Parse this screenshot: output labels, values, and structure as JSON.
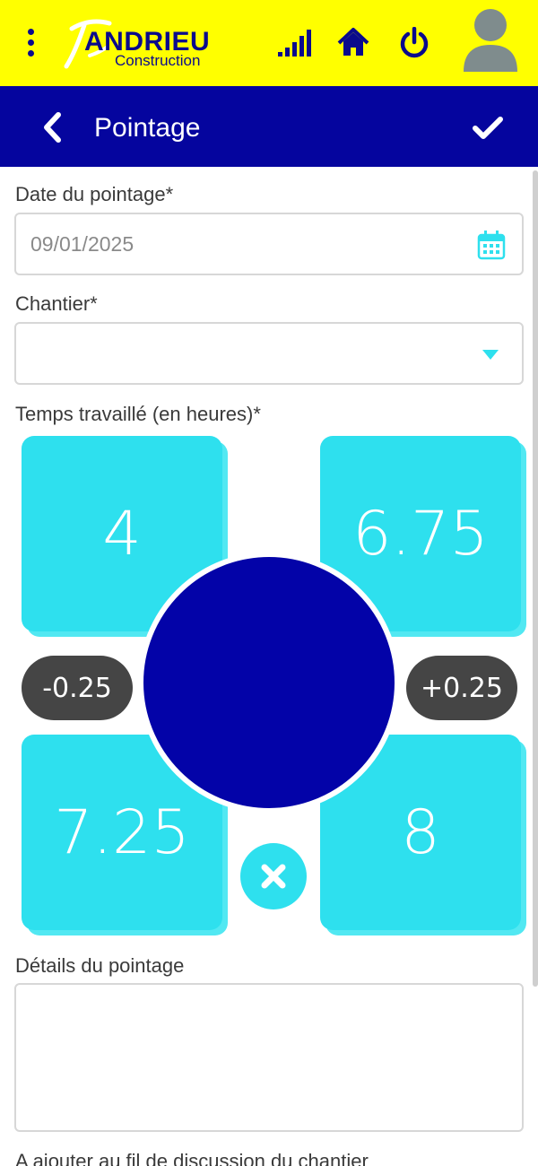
{
  "header": {
    "logo_name": "ANDRIEU",
    "logo_sub": "Construction",
    "icons": [
      "menu-dots-icon",
      "signal-icon",
      "home-icon",
      "power-icon",
      "avatar-icon"
    ],
    "colors": {
      "background": "#ffff00",
      "icons": "#0a0a8c"
    }
  },
  "navbar": {
    "title": "Pointage",
    "back_icon": "chevron-left-icon",
    "confirm_icon": "check-icon",
    "color": "#05059e"
  },
  "form": {
    "date_label": "Date du pointage*",
    "date_value": "09/01/2025",
    "chantier_label": "Chantier*",
    "chantier_value": "",
    "time_label": "Temps travaillé (en heures)*",
    "details_label": "Détails du pointage",
    "details_value": "",
    "thread_label": "A ajouter au fil de discussion du chantier"
  },
  "time_picker": {
    "presets": [
      "4",
      "6.75",
      "7.25",
      "8"
    ],
    "decrement_label": "-0.25",
    "increment_label": "+0.25",
    "current_value": "",
    "tile_color": "#2ee0ee",
    "center_color": "#0303a8"
  }
}
